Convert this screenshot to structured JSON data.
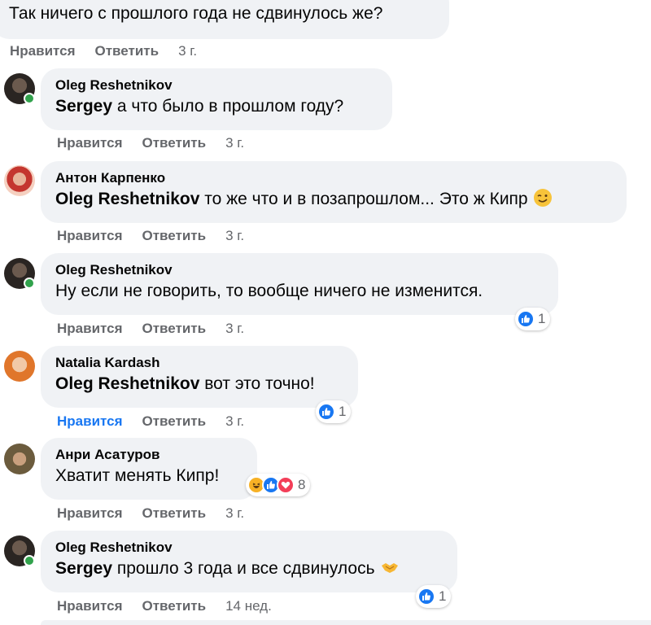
{
  "comments": [
    {
      "author": "",
      "text": "Так ничего с прошлого года не сдвинулось же?",
      "like_label": "Нравится",
      "reply_label": "Ответить",
      "time": "3 г."
    },
    {
      "author": "Oleg Reshetnikov",
      "mention": "Sergey",
      "text": " а что было в прошлом году?",
      "like_label": "Нравится",
      "reply_label": "Ответить",
      "time": "3 г."
    },
    {
      "author": "Антон Карпенко",
      "mention": "Oleg Reshetnikov",
      "text": " то же что и в позапрошлом... Это ж Кипр",
      "emoji": "winking-face-emoji",
      "like_label": "Нравится",
      "reply_label": "Ответить",
      "time": "3 г."
    },
    {
      "author": "Oleg Reshetnikov",
      "text": "Ну если не говорить, то вообще ничего не изменится.",
      "reaction_count": "1",
      "like_label": "Нравится",
      "reply_label": "Ответить",
      "time": "3 г."
    },
    {
      "author": "Natalia Kardash",
      "mention": "Oleg Reshetnikov",
      "text": " вот это точно!",
      "reaction_count": "1",
      "like_label": "Нравится",
      "like_active": true,
      "reply_label": "Ответить",
      "time": "3 г."
    },
    {
      "author": "Анри Асатуров",
      "text": "Хватит менять Кипр!",
      "reaction_count": "8",
      "like_label": "Нравится",
      "reply_label": "Ответить",
      "time": "3 г."
    },
    {
      "author": "Oleg Reshetnikov",
      "mention": "Sergey",
      "text": " прошло 3 года и все сдвинулось",
      "emoji": "handshake-emoji",
      "reaction_count": "1",
      "like_label": "Нравится",
      "reply_label": "Ответить",
      "time": "14 нед."
    }
  ],
  "colors": {
    "bubble": "#f0f2f5",
    "action_text": "#65676b",
    "like_active": "#1877f2",
    "online": "#31a24c",
    "like_reaction": "#1877f2",
    "love_reaction": "#f33e58",
    "haha_reaction": "#f7b125"
  }
}
